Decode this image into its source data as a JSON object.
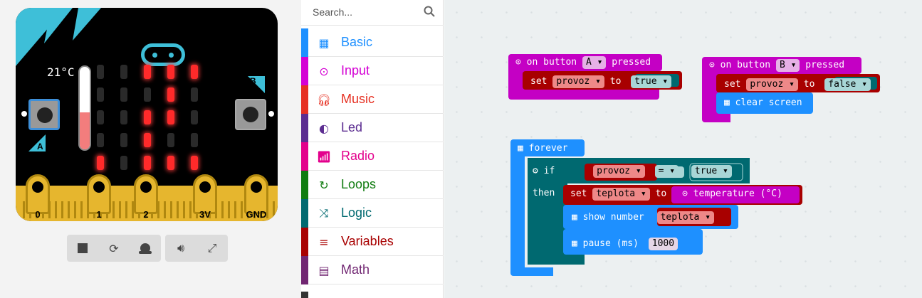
{
  "simulator": {
    "temperature_label": "21°C",
    "temperature_fill": 0.45,
    "led_matrix": [
      [
        0,
        0,
        1,
        1,
        1
      ],
      [
        0,
        0,
        0,
        1,
        0
      ],
      [
        0,
        0,
        1,
        1,
        0
      ],
      [
        0,
        0,
        1,
        0,
        0
      ],
      [
        1,
        0,
        1,
        1,
        1
      ]
    ],
    "button_a": "A",
    "button_b": "B",
    "pins": [
      "0",
      "1",
      "2",
      "3V",
      "GND"
    ],
    "toolbar": {
      "stop": "stop-icon",
      "restart": "restart-icon",
      "slowmo": "snail-icon",
      "mute": "speaker-icon",
      "fullscreen": "fullscreen-icon"
    }
  },
  "toolbox": {
    "search_placeholder": "Search...",
    "categories": [
      {
        "label": "Basic",
        "color": "#1e90ff",
        "icon": "grid-icon"
      },
      {
        "label": "Input",
        "color": "#d400d4",
        "icon": "target-icon"
      },
      {
        "label": "Music",
        "color": "#e63022",
        "icon": "headphones-icon"
      },
      {
        "label": "Led",
        "color": "#5c2d91",
        "icon": "toggle-icon"
      },
      {
        "label": "Radio",
        "color": "#e3008c",
        "icon": "signal-icon"
      },
      {
        "label": "Loops",
        "color": "#107c10",
        "icon": "loop-icon"
      },
      {
        "label": "Logic",
        "color": "#006970",
        "icon": "shuffle-icon"
      },
      {
        "label": "Variables",
        "color": "#a80000",
        "icon": "lines-icon"
      },
      {
        "label": "Math",
        "color": "#712672",
        "icon": "calculator-icon"
      }
    ]
  },
  "workspace": {
    "button_a_block": {
      "prefix": "on button",
      "button": "A",
      "suffix": "pressed",
      "set": "set",
      "var": "provoz",
      "to": "to",
      "value": "true"
    },
    "button_b_block": {
      "prefix": "on button",
      "button": "B",
      "suffix": "pressed",
      "set": "set",
      "var": "provoz",
      "to": "to",
      "value": "false",
      "clear": "clear screen"
    },
    "forever_block": {
      "label": "forever",
      "if": "if",
      "var": "provoz",
      "op": "=",
      "value": "true",
      "then": "then",
      "set": "set",
      "set_var": "teplota",
      "to": "to",
      "temperature": "temperature (°C)",
      "show": "show number",
      "show_var": "teplota",
      "pause": "pause (ms)",
      "pause_value": "1000"
    }
  },
  "colors": {
    "basic": "#1e90ff",
    "input": "#d400d4",
    "variables": "#a80000",
    "logic": "#006970"
  }
}
